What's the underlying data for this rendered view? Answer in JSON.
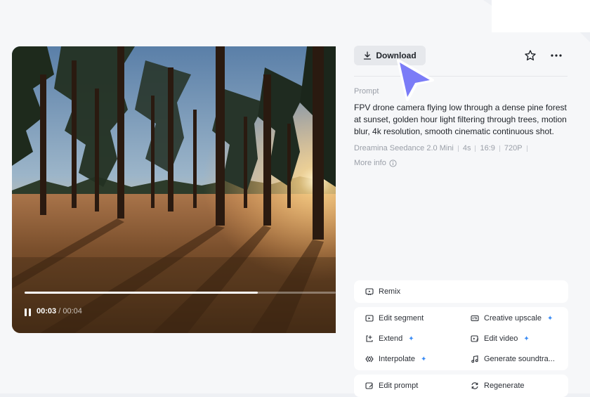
{
  "player": {
    "time_current": "00:03",
    "time_separator": "/",
    "time_total": "00:04",
    "progress": 0.75
  },
  "panel": {
    "download_label": "Download",
    "prompt_label": "Prompt",
    "prompt_text": "FPV drone camera flying low through a dense pine forest at sunset, golden hour light filtering through trees, motion blur, 4k resolution, smooth cinematic continuous shot.",
    "meta": [
      "Dreamina Seedance 2.0 Mini",
      "4s",
      "16:9",
      "720P"
    ],
    "more_info_label": "More info"
  },
  "actions": {
    "remix": "Remix",
    "edit_segment": "Edit segment",
    "creative_upscale": "Creative upscale",
    "extend": "Extend",
    "edit_video": "Edit video",
    "interpolate": "Interpolate",
    "generate_soundtrack": "Generate soundtra...",
    "edit_prompt": "Edit prompt",
    "regenerate": "Regenerate",
    "sparkle": "✦"
  },
  "colors": {
    "accent_cursor": "#7b7cf7",
    "sparkle": "#3b8cf5"
  }
}
